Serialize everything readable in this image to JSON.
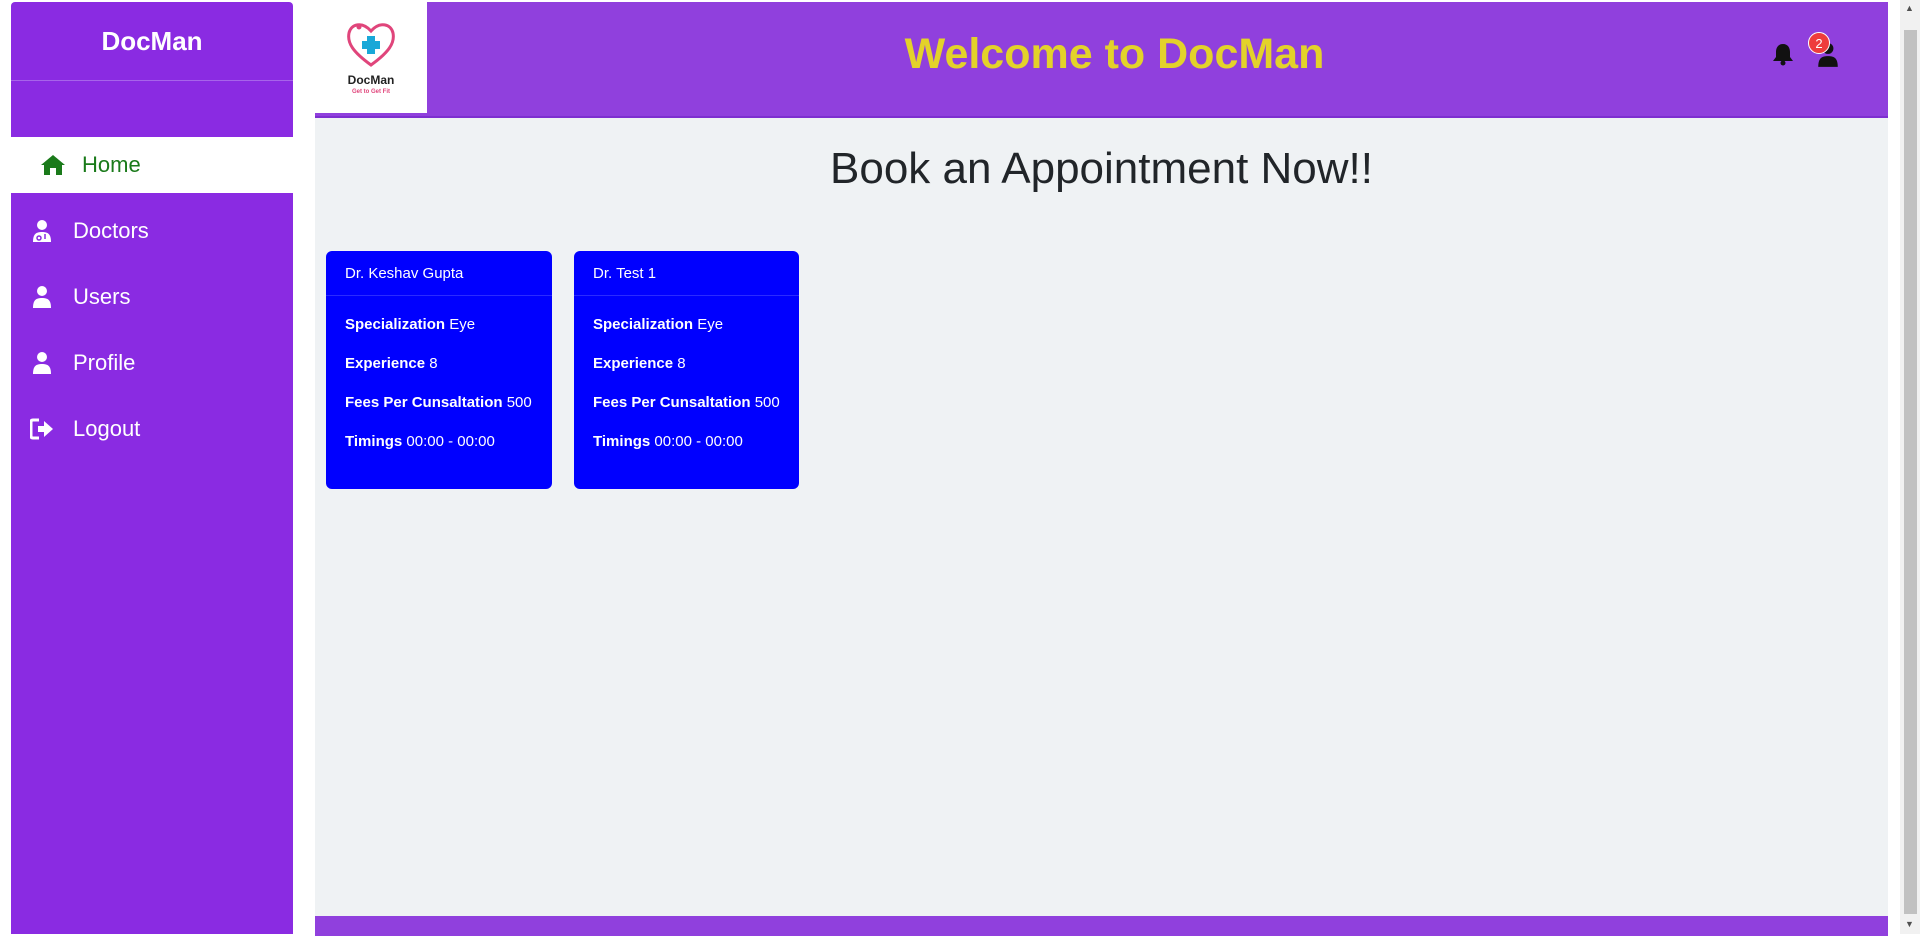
{
  "sidebar": {
    "brand": "DocMan",
    "items": [
      {
        "label": "Home",
        "icon": "home-icon",
        "active": true
      },
      {
        "label": "Doctors",
        "icon": "user-doctor-icon"
      },
      {
        "label": "Users",
        "icon": "user-icon"
      },
      {
        "label": "Profile",
        "icon": "user-icon"
      },
      {
        "label": "Logout",
        "icon": "logout-icon"
      }
    ]
  },
  "header": {
    "logo_name": "DocMan",
    "logo_tagline": "Get to Get Fit",
    "welcome": "Welcome to DocMan",
    "notification_count": "2"
  },
  "main": {
    "title": "Book an Appointment Now!!",
    "doctors": [
      {
        "name": "Dr. Keshav Gupta",
        "specialization_label": "Specialization",
        "specialization": "Eye",
        "experience_label": "Experience",
        "experience": "8",
        "fees_label": "Fees Per Cunsaltation",
        "fees": "500",
        "timings_label": "Timings",
        "timings": "00:00 - 00:00"
      },
      {
        "name": "Dr. Test 1",
        "specialization_label": "Specialization",
        "specialization": "Eye",
        "experience_label": "Experience",
        "experience": "8",
        "fees_label": "Fees Per Cunsaltation",
        "fees": "500",
        "timings_label": "Timings",
        "timings": "00:00 - 00:00"
      }
    ]
  },
  "colors": {
    "sidebar": "#8a2be2",
    "header": "#9040dd",
    "welcome_text": "#e3d22a",
    "card": "#0000ff",
    "active_item_text": "#1a7a1a"
  }
}
